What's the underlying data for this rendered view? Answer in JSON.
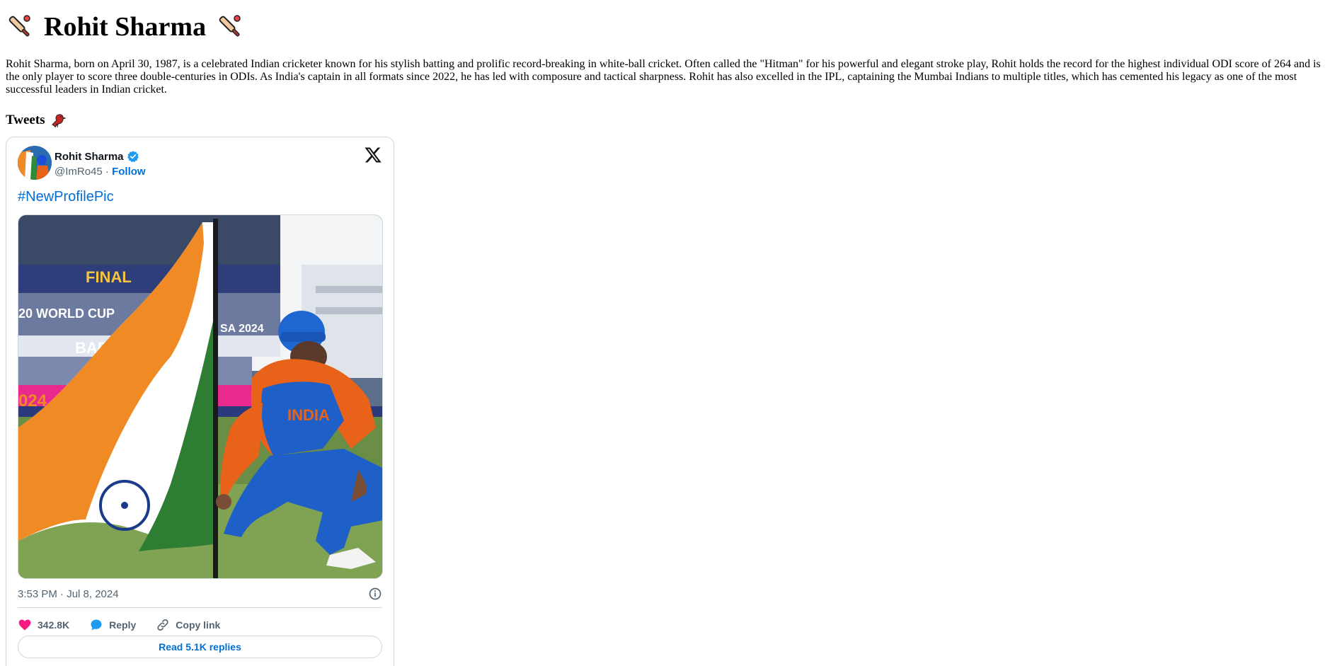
{
  "page": {
    "title": "Rohit Sharma",
    "title_icon": "cricket-bat-icon",
    "bio": "Rohit Sharma, born on April 30, 1987, is a celebrated Indian cricketer known for his stylish batting and prolific record-breaking in white-ball cricket. Often called the \"Hitman\" for his powerful and elegant stroke play, Rohit holds the record for the highest individual ODI score of 264 and is the only player to score three double-centuries in ODIs. As India's captain in all formats since 2022, he has led with composure and tactical sharpness. Rohit has also excelled in the IPL, captaining the Mumbai Indians to multiple titles, which has cemented his legacy as one of the most successful leaders in Indian cricket.",
    "tweets_heading": "Tweets",
    "tweets_icon": "bird-icon"
  },
  "tweet": {
    "author_name": "Rohit Sharma",
    "handle": "@ImRo45",
    "separator": " · ",
    "follow_label": "Follow",
    "text": "#NewProfilePic",
    "timestamp": "3:53 PM · Jul 8, 2024",
    "likes": "342.8K",
    "reply_label": "Reply",
    "copy_link_label": "Copy link",
    "read_replies_label": "Read 5.1K replies",
    "colors": {
      "link": "#006fd6",
      "heart": "#f91880",
      "reply": "#1d9bf0",
      "verified": "#1d9bf0"
    }
  }
}
